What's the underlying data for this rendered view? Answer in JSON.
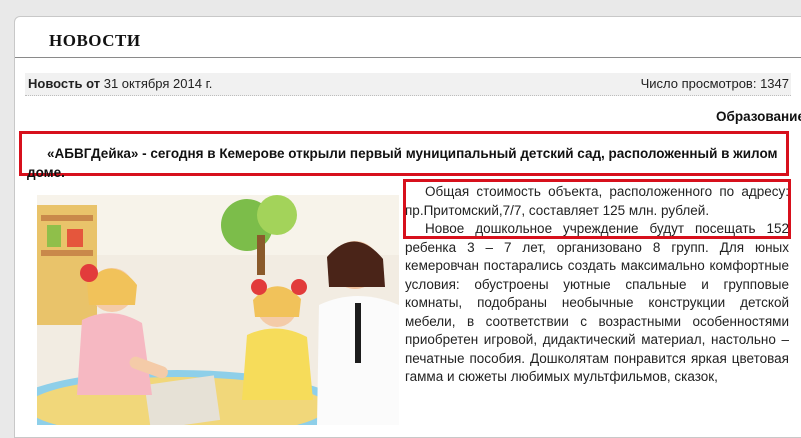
{
  "header": {
    "title": "НОВОСТИ"
  },
  "meta": {
    "label": "Новость от",
    "date": "31 октября 2014 г.",
    "views_label": "Число просмотров:",
    "views_count": "1347"
  },
  "category": "Образование",
  "headline": "«АБВГДейка» - сегодня в Кемерове открыли первый муниципальный детский сад, расположенный в жилом доме.",
  "paragraphs": [
    "Общая стоимость объекта, расположенного по адресу: пр.Притомский,7/7, составляет 125 млн. рублей.",
    "Новое дошкольное учреждение будут посещать 152 ребенка 3 – 7 лет, организовано 8 групп. Для юных кемеровчан постарались создать максимально комфортные условия: обустроены уютные спальные и групповые комнаты, подобраны необычные конструкции детской мебели, в соответствии с возрастными особенностями приобретен игровой, дидактический материал, настольно – печатные пособия. Дошколятам понравится яркая цветовая гамма и сюжеты любимых мультфильмов, сказок,"
  ],
  "colors": {
    "highlight": "#d7101c",
    "meta_bg": "#f1f1f1"
  }
}
